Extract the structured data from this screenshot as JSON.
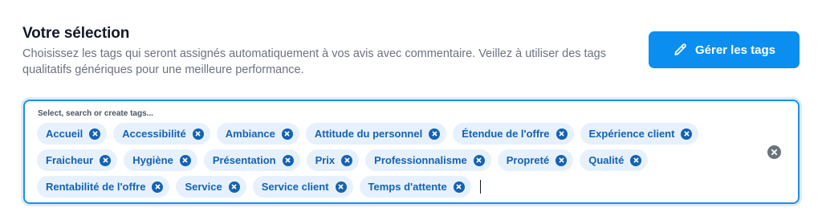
{
  "header": {
    "title": "Votre sélection",
    "subtitle": "Choisissez les tags qui seront assignés automatiquement à vos avis avec commentaire. Veillez à utiliser des tags qualitatifs génériques pour une meilleure performance."
  },
  "manage_button": {
    "label": "Gérer les tags",
    "icon": "pencil-icon"
  },
  "tag_input": {
    "placeholder": "Select, search or create tags...",
    "rows": [
      [
        "Accueil",
        "Accessibilité",
        "Ambiance",
        "Attitude du personnel",
        "Étendue de l'offre",
        "Expérience client"
      ],
      [
        "Fraicheur",
        "Hygiène",
        "Présentation",
        "Prix",
        "Professionnalisme",
        "Propreté",
        "Qualité"
      ],
      [
        "Rentabilité de l'offre",
        "Service",
        "Service client",
        "Temps d'attente"
      ]
    ],
    "clear_icon": "clear-all-icon"
  },
  "colors": {
    "accent": "#0a8ff0",
    "tag_bg": "#e6f1fd",
    "tag_text": "#1462b3",
    "clear": "#6b7280"
  }
}
